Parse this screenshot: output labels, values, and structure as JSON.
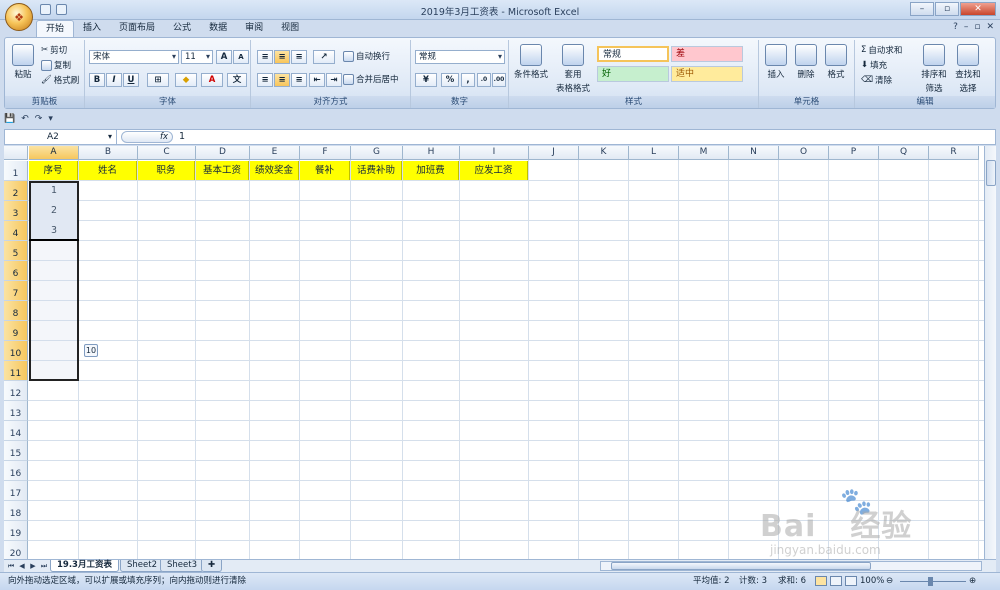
{
  "window": {
    "title": "2019年3月工资表 - Microsoft Excel"
  },
  "tabs": [
    "开始",
    "插入",
    "页面布局",
    "公式",
    "数据",
    "审阅",
    "视图"
  ],
  "ribbon": {
    "clipboard": {
      "label": "剪贴板",
      "paste": "粘贴",
      "cut": "剪切",
      "copy": "复制",
      "format_painter": "格式刷"
    },
    "font": {
      "label": "字体",
      "font_name": "宋体",
      "font_size": "11",
      "bold": "B",
      "italic": "I",
      "underline": "U",
      "grow": "A",
      "shrink": "A"
    },
    "alignment": {
      "label": "对齐方式",
      "wrap": "自动换行",
      "merge": "合并后居中"
    },
    "number": {
      "label": "数字",
      "format": "常规",
      "percent": "%"
    },
    "styles": {
      "label": "样式",
      "conditional": "条件格式",
      "table_format_1": "套用",
      "table_format_2": "表格格式",
      "normal": "常规",
      "bad": "差",
      "good": "好",
      "neutral": "适中"
    },
    "cells": {
      "label": "单元格",
      "insert": "插入",
      "delete": "删除",
      "format": "格式"
    },
    "editing": {
      "label": "编辑",
      "autosum": "自动求和",
      "fill": "填充",
      "clear": "清除",
      "sort_1": "排序和",
      "sort_2": "筛选",
      "find_1": "查找和",
      "find_2": "选择"
    }
  },
  "formula_bar": {
    "name_box": "A2",
    "fx": "fx",
    "value": "1"
  },
  "columns": [
    "A",
    "B",
    "C",
    "D",
    "E",
    "F",
    "G",
    "H",
    "I",
    "J",
    "K",
    "L",
    "M",
    "N",
    "O",
    "P",
    "Q",
    "R"
  ],
  "rows": [
    "1",
    "2",
    "3",
    "4",
    "5",
    "6",
    "7",
    "8",
    "9",
    "10",
    "11",
    "12",
    "13",
    "14",
    "15",
    "16",
    "17",
    "18",
    "19",
    "20"
  ],
  "header_row": [
    "序号",
    "姓名",
    "职务",
    "基本工资",
    "绩效奖金",
    "餐补",
    "话费补助",
    "加班费",
    "应发工资"
  ],
  "data_cells": [
    "1",
    "2",
    "3"
  ],
  "autofill_tooltip": "10",
  "sheets": [
    "19.3月工资表",
    "Sheet2",
    "Sheet3"
  ],
  "status": {
    "message": "向外拖动选定区域，可以扩展或填充序列；向内拖动则进行清除",
    "average": "平均值: 2",
    "count": "计数: 3",
    "sum": "求和: 6",
    "zoom": "100%"
  },
  "watermark": {
    "brand": "Bai",
    "brand_cn": "经验",
    "url": "jingyan.baidu.com"
  }
}
